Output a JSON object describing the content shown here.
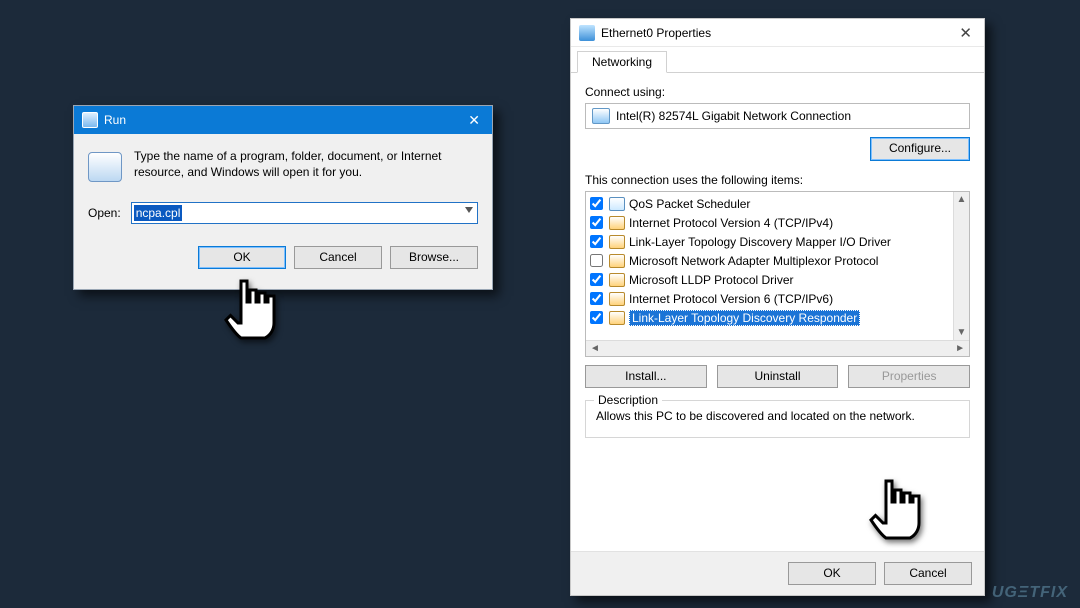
{
  "run": {
    "title": "Run",
    "desc": "Type the name of a program, folder, document, or Internet resource, and Windows will open it for you.",
    "open_label": "Open:",
    "value": "ncpa.cpl",
    "buttons": {
      "ok": "OK",
      "cancel": "Cancel",
      "browse": "Browse..."
    }
  },
  "props": {
    "title": "Ethernet0 Properties",
    "tab": "Networking",
    "connect_using_label": "Connect using:",
    "adapter": "Intel(R) 82574L Gigabit Network Connection",
    "configure": "Configure...",
    "items_label": "This connection uses the following items:",
    "items": [
      {
        "checked": true,
        "kind": "drv",
        "label": "QoS Packet Scheduler"
      },
      {
        "checked": true,
        "kind": "svc",
        "label": "Internet Protocol Version 4 (TCP/IPv4)"
      },
      {
        "checked": true,
        "kind": "svc",
        "label": "Link-Layer Topology Discovery Mapper I/O Driver"
      },
      {
        "checked": false,
        "kind": "svc",
        "label": "Microsoft Network Adapter Multiplexor Protocol"
      },
      {
        "checked": true,
        "kind": "svc",
        "label": "Microsoft LLDP Protocol Driver"
      },
      {
        "checked": true,
        "kind": "svc",
        "label": "Internet Protocol Version 6 (TCP/IPv6)"
      },
      {
        "checked": true,
        "kind": "svc",
        "label": "Link-Layer Topology Discovery Responder",
        "selected": true
      }
    ],
    "btns": {
      "install": "Install...",
      "uninstall": "Uninstall",
      "properties": "Properties"
    },
    "desc_legend": "Description",
    "desc_text": "Allows this PC to be discovered and located on the network.",
    "ok": "OK",
    "cancel": "Cancel"
  },
  "watermark": "UGΞTFIX"
}
